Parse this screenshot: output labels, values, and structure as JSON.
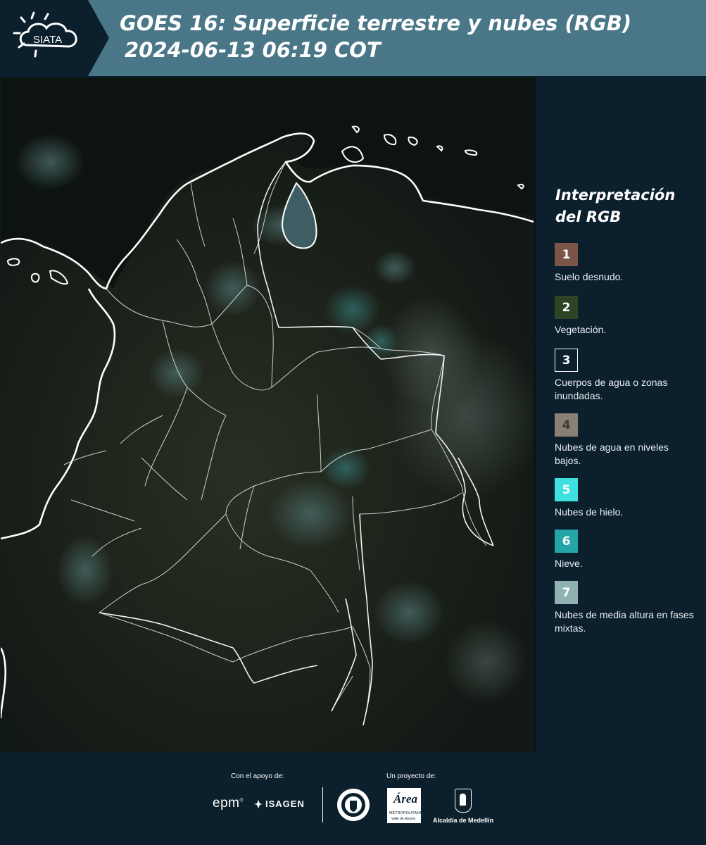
{
  "header": {
    "logo_text": "SIATA",
    "title_line1": "GOES 16: Superficie terrestre y nubes (RGB)",
    "title_line2": "2024-06-13 06:19 COT",
    "background_color": "#4a7787",
    "logo_background_color": "#0b1f2c"
  },
  "map": {
    "description_icon": "satellite-rgb-imagery",
    "boundary_color": "#ffffff"
  },
  "legend": {
    "title": "Interpretación del RGB",
    "items": [
      {
        "number": "1",
        "label": "Suelo desnudo.",
        "color": "#7a5548"
      },
      {
        "number": "2",
        "label": "Vegetación.",
        "color": "#2f4425"
      },
      {
        "number": "3",
        "label": "Cuerpos de agua o zonas inundadas.",
        "color": "#0b1f2c"
      },
      {
        "number": "4",
        "label": "Nubes de agua en niveles bajos.",
        "color": "#8a8174"
      },
      {
        "number": "5",
        "label": "Nubes de hielo.",
        "color": "#3ee0e0"
      },
      {
        "number": "6",
        "label": "Nieve.",
        "color": "#24a5a8"
      },
      {
        "number": "7",
        "label": "Nubes de media altura en fases mixtas.",
        "color": "#8fb1b1"
      }
    ]
  },
  "footer": {
    "support_label": "Con el apoyo de:",
    "project_label": "Un proyecto de:",
    "sponsors": [
      "epm",
      "ISAGEN"
    ],
    "partners": {
      "area_word": "Área",
      "area_sub": "METROPOLITANA",
      "area_sub2": "Valle de Aburrá",
      "alcaldia": "Alcaldía de Medellín"
    }
  }
}
